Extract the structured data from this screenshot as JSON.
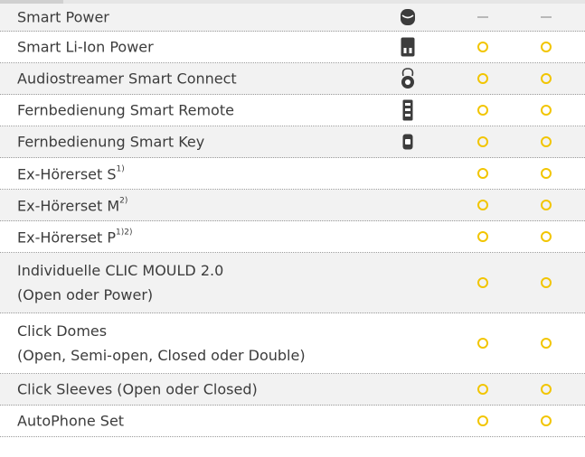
{
  "accessories": [
    {
      "name": "Smart Power",
      "icon": "battery-pack-icon",
      "col1": "–",
      "col2": "–"
    },
    {
      "name": "Smart Li-Ion Power",
      "icon": "li-ion-battery-icon",
      "col1": "○",
      "col2": "○"
    },
    {
      "name": "Audiostreamer Smart Connect",
      "icon": "neck-loop-streamer-icon",
      "col1": "○",
      "col2": "○"
    },
    {
      "name": "Fernbedienung Smart Remote",
      "icon": "remote-control-icon",
      "col1": "○",
      "col2": "○"
    },
    {
      "name": "Fernbedienung Smart Key",
      "icon": "key-remote-icon",
      "col1": "○",
      "col2": "○"
    },
    {
      "name": "Ex-Hörerset S",
      "sup": "1)",
      "col1": "○",
      "col2": "○"
    },
    {
      "name": "Ex-Hörerset M",
      "sup": "2)",
      "col1": "○",
      "col2": "○"
    },
    {
      "name": "Ex-Hörerset P",
      "sup": "1)2)",
      "col1": "○",
      "col2": "○"
    },
    {
      "name": "Individuelle CLIC MOULD 2.0",
      "name2": "(Open oder Power)",
      "col1": "○",
      "col2": "○"
    },
    {
      "name": "Click Domes",
      "name2": "(Open, Semi-open, Closed oder Double)",
      "col1": "○",
      "col2": "○"
    },
    {
      "name": "Click Sleeves (Open oder Closed)",
      "col1": "○",
      "col2": "○"
    },
    {
      "name": "AutoPhone Set",
      "col1": "○",
      "col2": "○"
    }
  ],
  "colors": {
    "accent": "#f2c500",
    "alt_row": "#f2f2f2",
    "dash": "#b8b8b8"
  }
}
